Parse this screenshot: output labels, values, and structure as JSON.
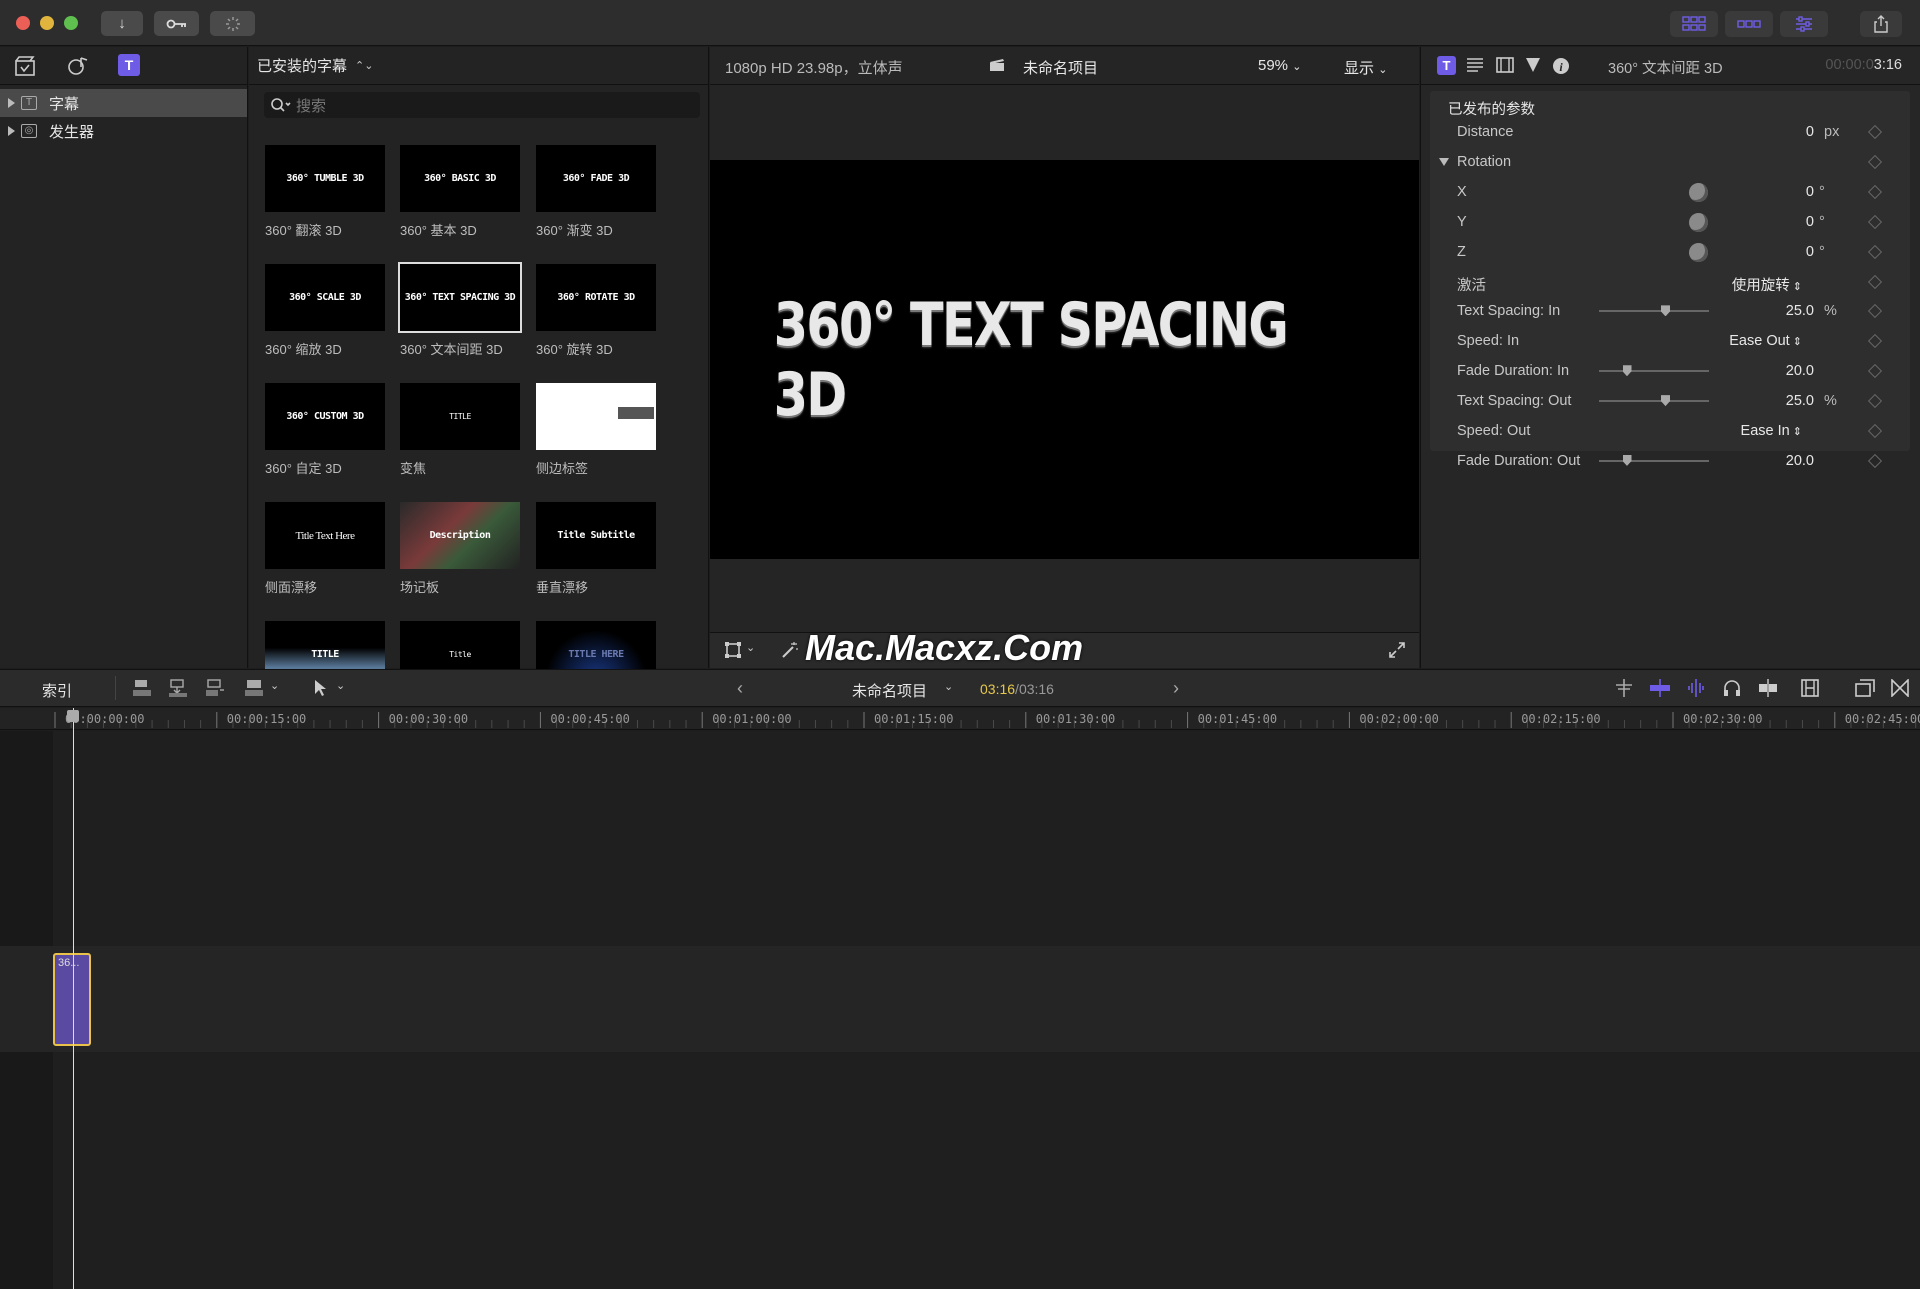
{
  "window": {
    "toolbar_icons": [
      "import-arrow-icon",
      "key-icon",
      "progress-spinner-icon"
    ],
    "view_buttons": [
      "browser-grid-icon",
      "timeline-icon",
      "inspector-sliders-icon"
    ],
    "share_icon": "share-icon"
  },
  "sidebar": {
    "tabs": [
      "libraries-icon",
      "photos-audio-icon",
      "titles-generators-icon"
    ],
    "items": [
      {
        "label": "字幕",
        "selected": true
      },
      {
        "label": "发生器",
        "selected": false
      }
    ]
  },
  "browser": {
    "header": "已安装的字幕",
    "search_placeholder": "搜索",
    "tiles": [
      {
        "thumb": "360° TUMBLE 3D",
        "label": "360° 翻滚 3D"
      },
      {
        "thumb": "360° BASIC 3D",
        "label": "360° 基本 3D"
      },
      {
        "thumb": "360° FADE 3D",
        "label": "360° 渐变 3D"
      },
      {
        "thumb": "360° SCALE 3D",
        "label": "360° 缩放 3D"
      },
      {
        "thumb": "360° TEXT SPACING 3D",
        "label": "360° 文本间距 3D",
        "selected": true
      },
      {
        "thumb": "360° ROTATE 3D",
        "label": "360° 旋转 3D"
      },
      {
        "thumb": "360° CUSTOM 3D",
        "label": "360° 自定 3D"
      },
      {
        "thumb": "TITLE",
        "label": "变焦"
      },
      {
        "thumb": "",
        "label": "侧边标签"
      },
      {
        "thumb": "Title Text Here",
        "label": "侧面漂移"
      },
      {
        "thumb": "Description",
        "label": "场记板"
      },
      {
        "thumb": "Title Subtitle",
        "label": "垂直漂移"
      },
      {
        "thumb": "TITLE",
        "label": ""
      },
      {
        "thumb": "Title",
        "label": ""
      },
      {
        "thumb": "TITLE HERE",
        "label": ""
      }
    ]
  },
  "viewer": {
    "format": "1080p HD 23.98p，立体声",
    "project": "未命名项目",
    "zoom": "59%",
    "display": "显示",
    "canvas_text": "360° TEXT SPACING 3D",
    "watermark": "Mac.Macxz.Com"
  },
  "inspector": {
    "title": "360° 文本间距 3D",
    "timecode_dim": "00:00:0",
    "timecode": "3:16",
    "section": "已发布的参数",
    "params": [
      {
        "label": "Distance",
        "value": "0",
        "unit": "px"
      },
      {
        "label": "Rotation",
        "group": true
      },
      {
        "label": "X",
        "value": "0",
        "unit": "°",
        "dial": true
      },
      {
        "label": "Y",
        "value": "0",
        "unit": "°",
        "dial": true
      },
      {
        "label": "Z",
        "value": "0",
        "unit": "°",
        "dial": true
      },
      {
        "label": "激活",
        "popup": "使用旋转"
      },
      {
        "label": "Text Spacing: In",
        "value": "25.0",
        "unit": "%",
        "slider": 0.6
      },
      {
        "label": "Speed: In",
        "popup": "Ease Out"
      },
      {
        "label": "Fade Duration: In",
        "value": "20.0",
        "slider": 0.25
      },
      {
        "label": "Text Spacing: Out",
        "value": "25.0",
        "unit": "%",
        "slider": 0.6
      },
      {
        "label": "Speed: Out",
        "popup": "Ease In"
      },
      {
        "label": "Fade Duration: Out",
        "value": "20.0",
        "slider": 0.25
      }
    ]
  },
  "timeline": {
    "index_label": "索引",
    "project": "未命名项目",
    "current_time": "03:16",
    "separator": "/",
    "total_time": "03:16",
    "ruler": [
      "00:00:00:00",
      "00:00:15:00",
      "00:00:30:00",
      "00:00:45:00",
      "00:01:00:00",
      "00:01:15:00",
      "00:01:30:00",
      "00:01:45:00",
      "00:02:00:00",
      "00:02:15:00",
      "00:02:30:00",
      "00:02:45:00"
    ],
    "clip_label": "36..."
  },
  "colors": {
    "accent": "#6e5ce6",
    "clip": "#5b4aa2",
    "clip_border": "#e8c24a",
    "timecode": "#e6c84b"
  }
}
